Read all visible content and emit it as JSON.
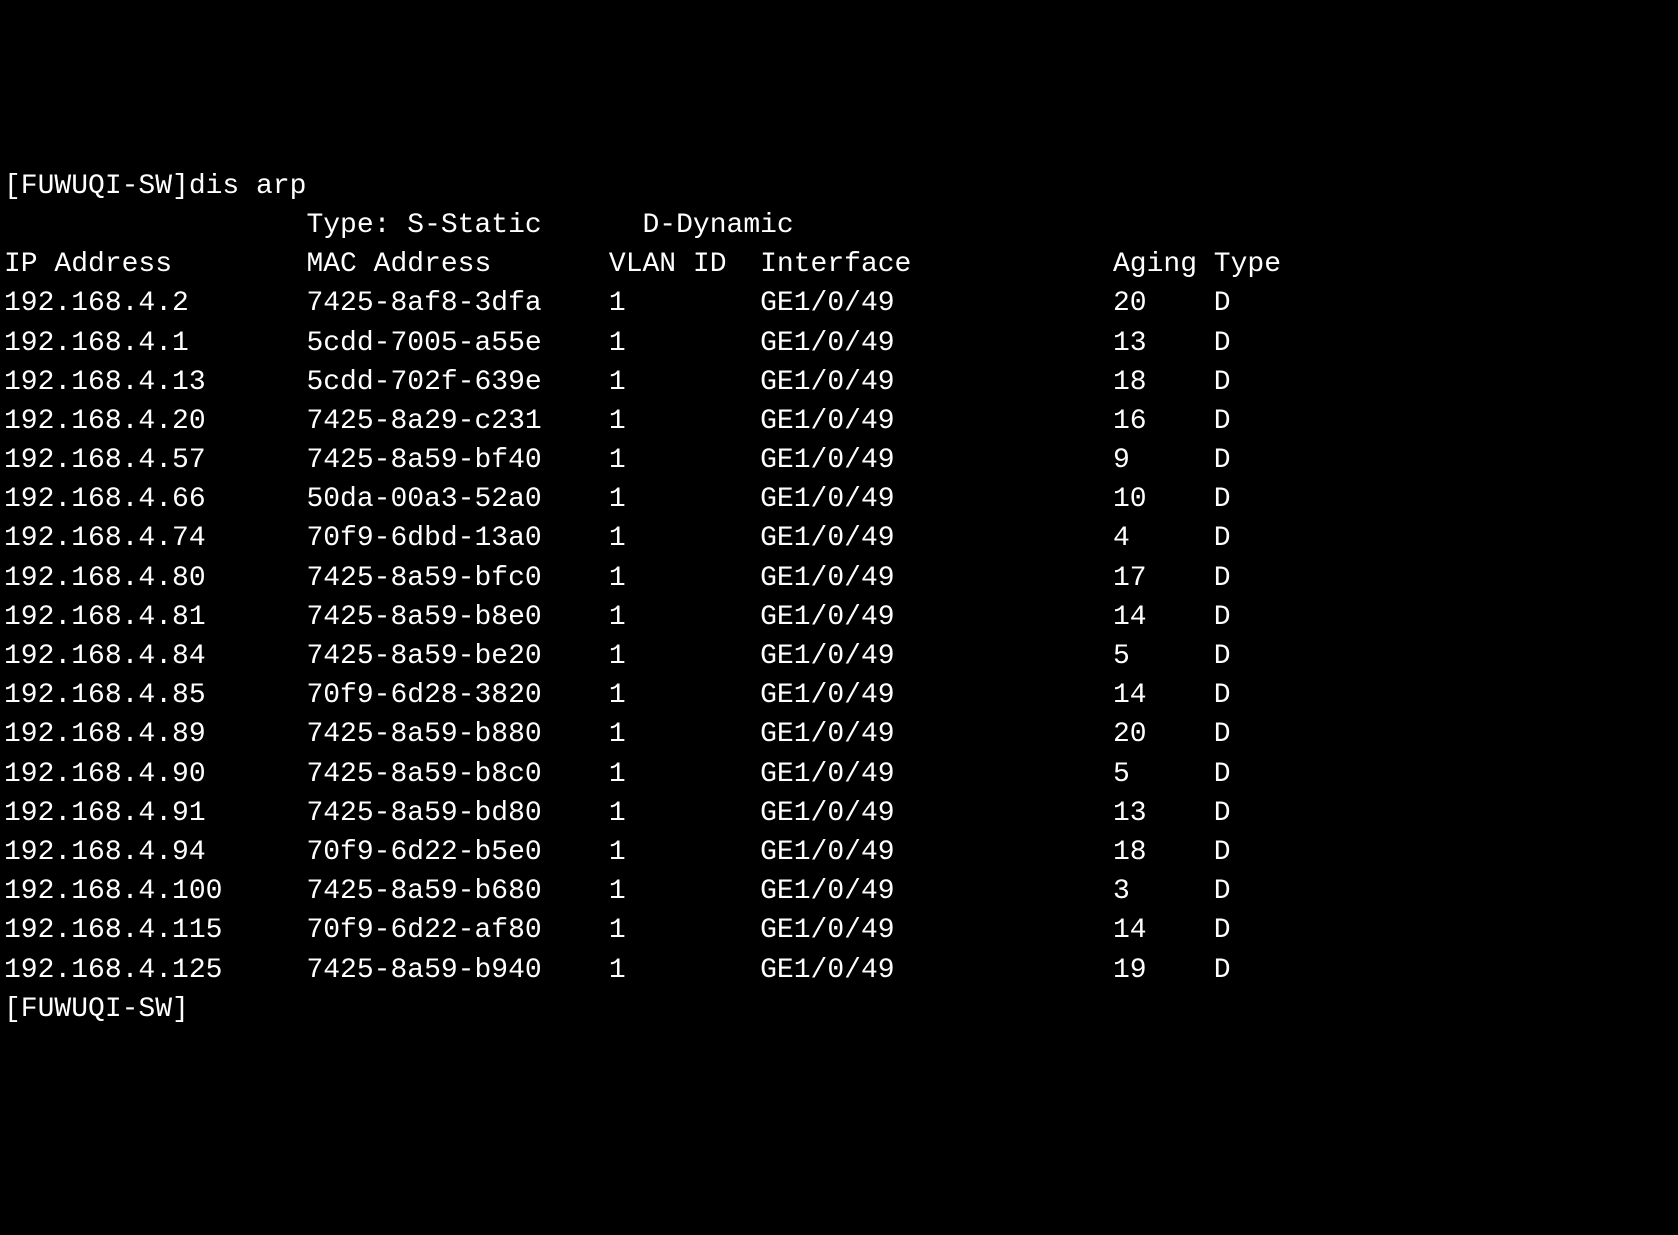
{
  "prompt_prefix": "[FUWUQI-SW]",
  "command": "dis arp",
  "type_legend_prefix": "                  Type: ",
  "type_legend_static": "S-Static",
  "type_legend_dynamic": "D-Dynamic",
  "headers": {
    "ip": "IP Address",
    "mac": "MAC Address",
    "vlan": "VLAN ID",
    "interface": "Interface",
    "aging": "Aging",
    "type": "Type"
  },
  "rows": [
    {
      "ip": "192.168.4.2",
      "mac": "7425-8af8-3dfa",
      "vlan": "1",
      "interface": "GE1/0/49",
      "aging": "20",
      "type": "D"
    },
    {
      "ip": "192.168.4.1",
      "mac": "5cdd-7005-a55e",
      "vlan": "1",
      "interface": "GE1/0/49",
      "aging": "13",
      "type": "D"
    },
    {
      "ip": "192.168.4.13",
      "mac": "5cdd-702f-639e",
      "vlan": "1",
      "interface": "GE1/0/49",
      "aging": "18",
      "type": "D"
    },
    {
      "ip": "192.168.4.20",
      "mac": "7425-8a29-c231",
      "vlan": "1",
      "interface": "GE1/0/49",
      "aging": "16",
      "type": "D"
    },
    {
      "ip": "192.168.4.57",
      "mac": "7425-8a59-bf40",
      "vlan": "1",
      "interface": "GE1/0/49",
      "aging": "9",
      "type": "D"
    },
    {
      "ip": "192.168.4.66",
      "mac": "50da-00a3-52a0",
      "vlan": "1",
      "interface": "GE1/0/49",
      "aging": "10",
      "type": "D"
    },
    {
      "ip": "192.168.4.74",
      "mac": "70f9-6dbd-13a0",
      "vlan": "1",
      "interface": "GE1/0/49",
      "aging": "4",
      "type": "D"
    },
    {
      "ip": "192.168.4.80",
      "mac": "7425-8a59-bfc0",
      "vlan": "1",
      "interface": "GE1/0/49",
      "aging": "17",
      "type": "D"
    },
    {
      "ip": "192.168.4.81",
      "mac": "7425-8a59-b8e0",
      "vlan": "1",
      "interface": "GE1/0/49",
      "aging": "14",
      "type": "D"
    },
    {
      "ip": "192.168.4.84",
      "mac": "7425-8a59-be20",
      "vlan": "1",
      "interface": "GE1/0/49",
      "aging": "5",
      "type": "D"
    },
    {
      "ip": "192.168.4.85",
      "mac": "70f9-6d28-3820",
      "vlan": "1",
      "interface": "GE1/0/49",
      "aging": "14",
      "type": "D"
    },
    {
      "ip": "192.168.4.89",
      "mac": "7425-8a59-b880",
      "vlan": "1",
      "interface": "GE1/0/49",
      "aging": "20",
      "type": "D"
    },
    {
      "ip": "192.168.4.90",
      "mac": "7425-8a59-b8c0",
      "vlan": "1",
      "interface": "GE1/0/49",
      "aging": "5",
      "type": "D"
    },
    {
      "ip": "192.168.4.91",
      "mac": "7425-8a59-bd80",
      "vlan": "1",
      "interface": "GE1/0/49",
      "aging": "13",
      "type": "D"
    },
    {
      "ip": "192.168.4.94",
      "mac": "70f9-6d22-b5e0",
      "vlan": "1",
      "interface": "GE1/0/49",
      "aging": "18",
      "type": "D"
    },
    {
      "ip": "192.168.4.100",
      "mac": "7425-8a59-b680",
      "vlan": "1",
      "interface": "GE1/0/49",
      "aging": "3",
      "type": "D"
    },
    {
      "ip": "192.168.4.115",
      "mac": "70f9-6d22-af80",
      "vlan": "1",
      "interface": "GE1/0/49",
      "aging": "14",
      "type": "D"
    },
    {
      "ip": "192.168.4.125",
      "mac": "7425-8a59-b940",
      "vlan": "1",
      "interface": "GE1/0/49",
      "aging": "19",
      "type": "D"
    }
  ],
  "final_prompt": "[FUWUQI-SW]",
  "col_widths": {
    "ip": 18,
    "mac": 18,
    "vlan": 9,
    "interface": 21,
    "aging": 6,
    "type": 4
  }
}
